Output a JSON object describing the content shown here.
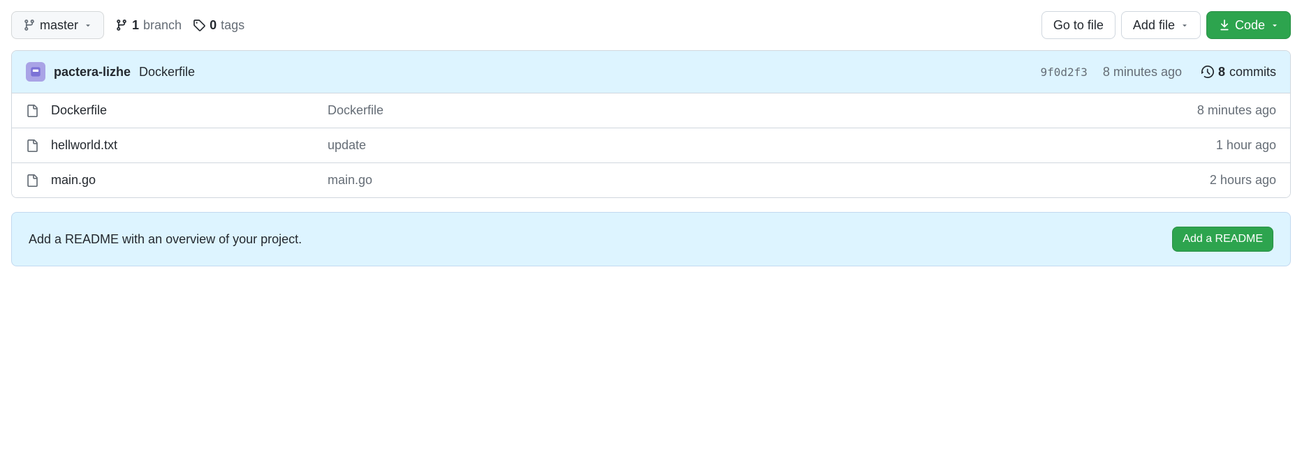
{
  "toolbar": {
    "branch_selector": "master",
    "branch_count": "1",
    "branch_label": "branch",
    "tag_count": "0",
    "tag_label": "tags",
    "go_to_file": "Go to file",
    "add_file": "Add file",
    "code": "Code"
  },
  "latest_commit": {
    "author": "pactera-lizhe",
    "message": "Dockerfile",
    "sha": "9f0d2f3",
    "time_ago": "8 minutes ago",
    "commit_count": "8",
    "commit_label": "commits"
  },
  "files": [
    {
      "name": "Dockerfile",
      "commit": "Dockerfile",
      "time": "8 minutes ago"
    },
    {
      "name": "hellworld.txt",
      "commit": "update",
      "time": "1 hour ago"
    },
    {
      "name": "main.go",
      "commit": "main.go",
      "time": "2 hours ago"
    }
  ],
  "readme_prompt": {
    "text": "Add a README with an overview of your project.",
    "button": "Add a README"
  }
}
